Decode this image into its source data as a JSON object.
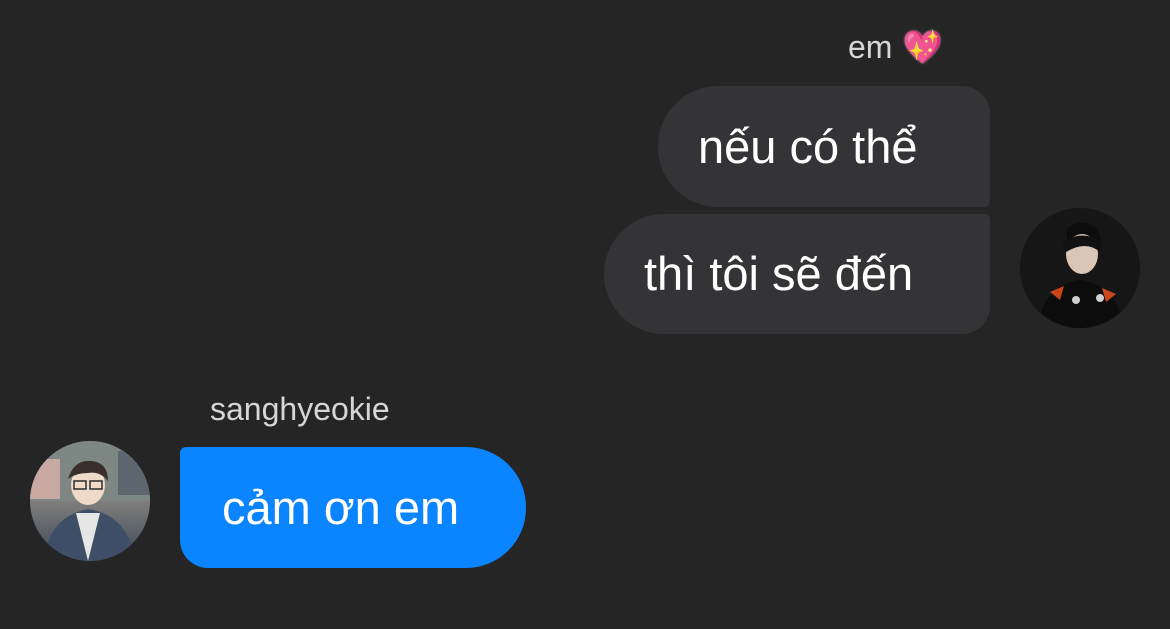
{
  "conversation": {
    "outgoing": {
      "sender": "em",
      "sender_emoji": "💖",
      "messages": [
        "nếu có thể",
        "thì tôi sẽ đến"
      ],
      "avatar": "user-photo-avatar"
    },
    "incoming": {
      "sender": "sanghyeokie",
      "messages": [
        "cảm ơn em"
      ],
      "avatar": "user-photo-avatar"
    }
  },
  "colors": {
    "background": "#252526",
    "outgoing_bubble": "#343437",
    "incoming_bubble": "#0a84ff",
    "text": "#ffffff",
    "sender_label": "#d6d6d6"
  }
}
